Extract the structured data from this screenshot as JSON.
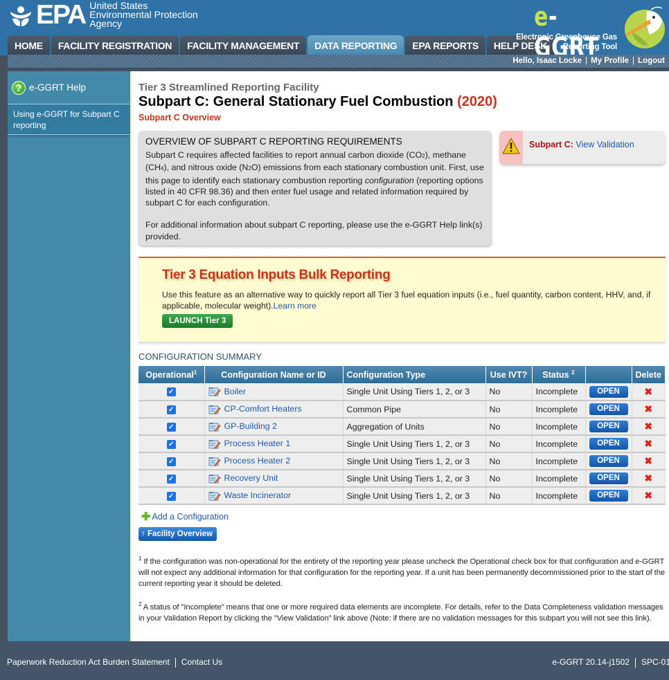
{
  "header": {
    "epa_logo_text": "EPA",
    "agency_lines": [
      "United States",
      "Environmental Protection",
      "Agency"
    ],
    "eggrt_logo": {
      "prefix": "e",
      "rest": "-GGRT"
    },
    "eggrt_subtitle": [
      "Electronic Greenhouse Gas",
      "Reporting Tool"
    ],
    "tabs": [
      {
        "label": "HOME",
        "active": false
      },
      {
        "label": "FACILITY REGISTRATION",
        "active": false
      },
      {
        "label": "FACILITY MANAGEMENT",
        "active": false
      },
      {
        "label": "DATA REPORTING",
        "active": true
      },
      {
        "label": "EPA REPORTS",
        "active": false
      },
      {
        "label": "HELP DESK",
        "active": false
      }
    ],
    "user_greeting": "Hello, Isaac Locke",
    "my_profile": "My Profile",
    "logout": "Logout",
    "separator": "|"
  },
  "sidebar": {
    "help_title": "e-GGRT Help",
    "help_icon": "question-circle-icon",
    "items": [
      {
        "label": "Using e-GGRT for Subpart C reporting"
      }
    ]
  },
  "main": {
    "facility_type": "Tier 3 Streamlined Reporting Facility",
    "title": "Subpart C: General Stationary Fuel Combustion",
    "year": "(2020)",
    "subtitle": "Subpart C Overview",
    "overview": {
      "heading": "OVERVIEW OF SUBPART C REPORTING REQUIREMENTS",
      "p1_a": "Subpart C requires affected facilities to report annual carbon dioxide (CO",
      "p1_co2_sub": "2",
      "p1_b": "), methane (CH",
      "p1_ch4_sub": "4",
      "p1_c": "), and nitrous oxide (N",
      "p1_n2o_sub": "2",
      "p1_d": "O) emissions from each stationary combustion unit. First, use this page to identify each stationary combustion reporting ",
      "p1_em": "configuration",
      "p1_e": " (reporting options listed in 40 CFR 98.36) and then enter fuel usage and related information required by subpart C for each configuration.",
      "p2": "For additional information about subpart C reporting, please use the e-GGRT Help link(s) provided."
    },
    "validation": {
      "icon": "warning-triangle-icon",
      "label": "Subpart C:",
      "link": "View Validation"
    },
    "tier3": {
      "title": "Tier 3 Equation Inputs Bulk Reporting",
      "text": "Use this feature as an alternative way to quickly report all Tier 3 fuel equation inputs (i.e., fuel quantity, carbon content, HHV, and, if applicable, molecular weight).",
      "learn_more": "Learn more",
      "button": "LAUNCH Tier 3"
    },
    "config_summary": {
      "heading": "CONFIGURATION SUMMARY",
      "columns": [
        {
          "label": "Operational",
          "sup": "1"
        },
        {
          "label": "Configuration Name or ID",
          "sup": ""
        },
        {
          "label": "Configuration Type",
          "sup": ""
        },
        {
          "label": "Use IVT?",
          "sup": ""
        },
        {
          "label": "Status",
          "sup": "2"
        },
        {
          "label": "",
          "sup": ""
        },
        {
          "label": "Delete",
          "sup": ""
        }
      ],
      "rows": [
        {
          "operational": true,
          "name": "Boiler",
          "type": "Single Unit Using Tiers 1, 2, or 3",
          "ivt": "No",
          "status": "Incomplete",
          "open": "OPEN"
        },
        {
          "operational": true,
          "name": "CP-Comfort Heaters",
          "type": "Common Pipe",
          "ivt": "No",
          "status": "Incomplete",
          "open": "OPEN"
        },
        {
          "operational": true,
          "name": "GP-Building 2",
          "type": "Aggregation of Units",
          "ivt": "No",
          "status": "Incomplete",
          "open": "OPEN"
        },
        {
          "operational": true,
          "name": "Process Heater 1",
          "type": "Single Unit Using Tiers 1, 2, or 3",
          "ivt": "No",
          "status": "Incomplete",
          "open": "OPEN"
        },
        {
          "operational": true,
          "name": "Process Heater 2",
          "type": "Single Unit Using Tiers 1, 2, or 3",
          "ivt": "No",
          "status": "Incomplete",
          "open": "OPEN"
        },
        {
          "operational": true,
          "name": "Recovery Unit",
          "type": "Single Unit Using Tiers 1, 2, or 3",
          "ivt": "No",
          "status": "Incomplete",
          "open": "OPEN"
        },
        {
          "operational": true,
          "name": "Waste Incinerator",
          "type": "Single Unit Using Tiers 1, 2, or 3",
          "ivt": "No",
          "status": "Incomplete",
          "open": "OPEN"
        }
      ],
      "add_configuration": "Add a Configuration",
      "facility_overview_button": "Facility Overview"
    },
    "footnotes": [
      {
        "num": "1",
        "text": " If the configuration was non-operational for the entirety of the reporting year please uncheck the Operational check box for that configuration and e-GGRT will not expect any additional information for that configuration for the reporting year. If a unit has been permanently decommissioned prior to the start of the current reporting year it should be deleted."
      },
      {
        "num": "2",
        "text": " A status of \"Incomplete\" means that one or more required data elements are incomplete. For details, refer to the Data Completeness validation messages in your Validation Report by clicking the \"View Validation\" link above (Note: if there are no validation messages for this subpart you will not see this link)."
      }
    ]
  },
  "footer": {
    "links": [
      "Paperwork Reduction Act Burden Statement",
      "Contact Us"
    ],
    "version": "e-GGRT 20.14-j1502",
    "server": "SPC-01"
  },
  "colors": {
    "header_blue": "#2f72a6",
    "sidebar_blue": "#4389aa",
    "accent_red": "#c9321b",
    "link_blue": "#1f5aa8",
    "tier3_bg": "#fefcd0"
  }
}
